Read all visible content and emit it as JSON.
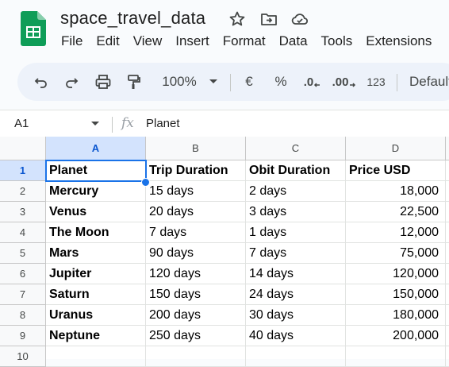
{
  "app": {
    "title": "space_travel_data",
    "menu": [
      "File",
      "Edit",
      "View",
      "Insert",
      "Format",
      "Data",
      "Tools",
      "Extensions"
    ]
  },
  "toolbar": {
    "zoom": "100%",
    "currency": "€",
    "percent": "%",
    "decimal_decrease": ".0",
    "decimal_increase": ".00",
    "number_format": "123",
    "font": "Default"
  },
  "formula_bar": {
    "cell_ref": "A1",
    "fx": "fx",
    "content": "Planet"
  },
  "grid": {
    "columns": [
      "A",
      "B",
      "C",
      "D"
    ],
    "row_numbers": [
      "1",
      "2",
      "3",
      "4",
      "5",
      "6",
      "7",
      "8",
      "9",
      "10"
    ],
    "rows": [
      [
        "Planet",
        "Trip Duration",
        "Obit Duration",
        "Price USD"
      ],
      [
        "Mercury",
        "15 days",
        "2 days",
        "18,000"
      ],
      [
        "Venus",
        "20 days",
        "3 days",
        "22,500"
      ],
      [
        "The Moon",
        "7 days",
        "1 days",
        "12,000"
      ],
      [
        "Mars",
        "90 days",
        "7 days",
        "75,000"
      ],
      [
        "Jupiter",
        "120 days",
        "14 days",
        "120,000"
      ],
      [
        "Saturn",
        "150 days",
        "24 days",
        "150,000"
      ],
      [
        "Uranus",
        "200 days",
        "30 days",
        "180,000"
      ],
      [
        "Neptune",
        "250 days",
        "40 days",
        "200,000"
      ],
      [
        "",
        "",
        "",
        ""
      ]
    ],
    "active_cell": "A1"
  },
  "icons": {
    "app_logo": "sheets-logo-icon",
    "star": "star-icon",
    "move": "move-to-folder-icon",
    "cloud": "cloud-status-icon",
    "undo": "undo-icon",
    "redo": "redo-icon",
    "print": "print-icon",
    "paint_format": "paint-format-icon"
  },
  "colors": {
    "brand_green": "#188038",
    "selection_blue": "#1a73e8",
    "header_selected_bg": "#d3e3fd"
  }
}
